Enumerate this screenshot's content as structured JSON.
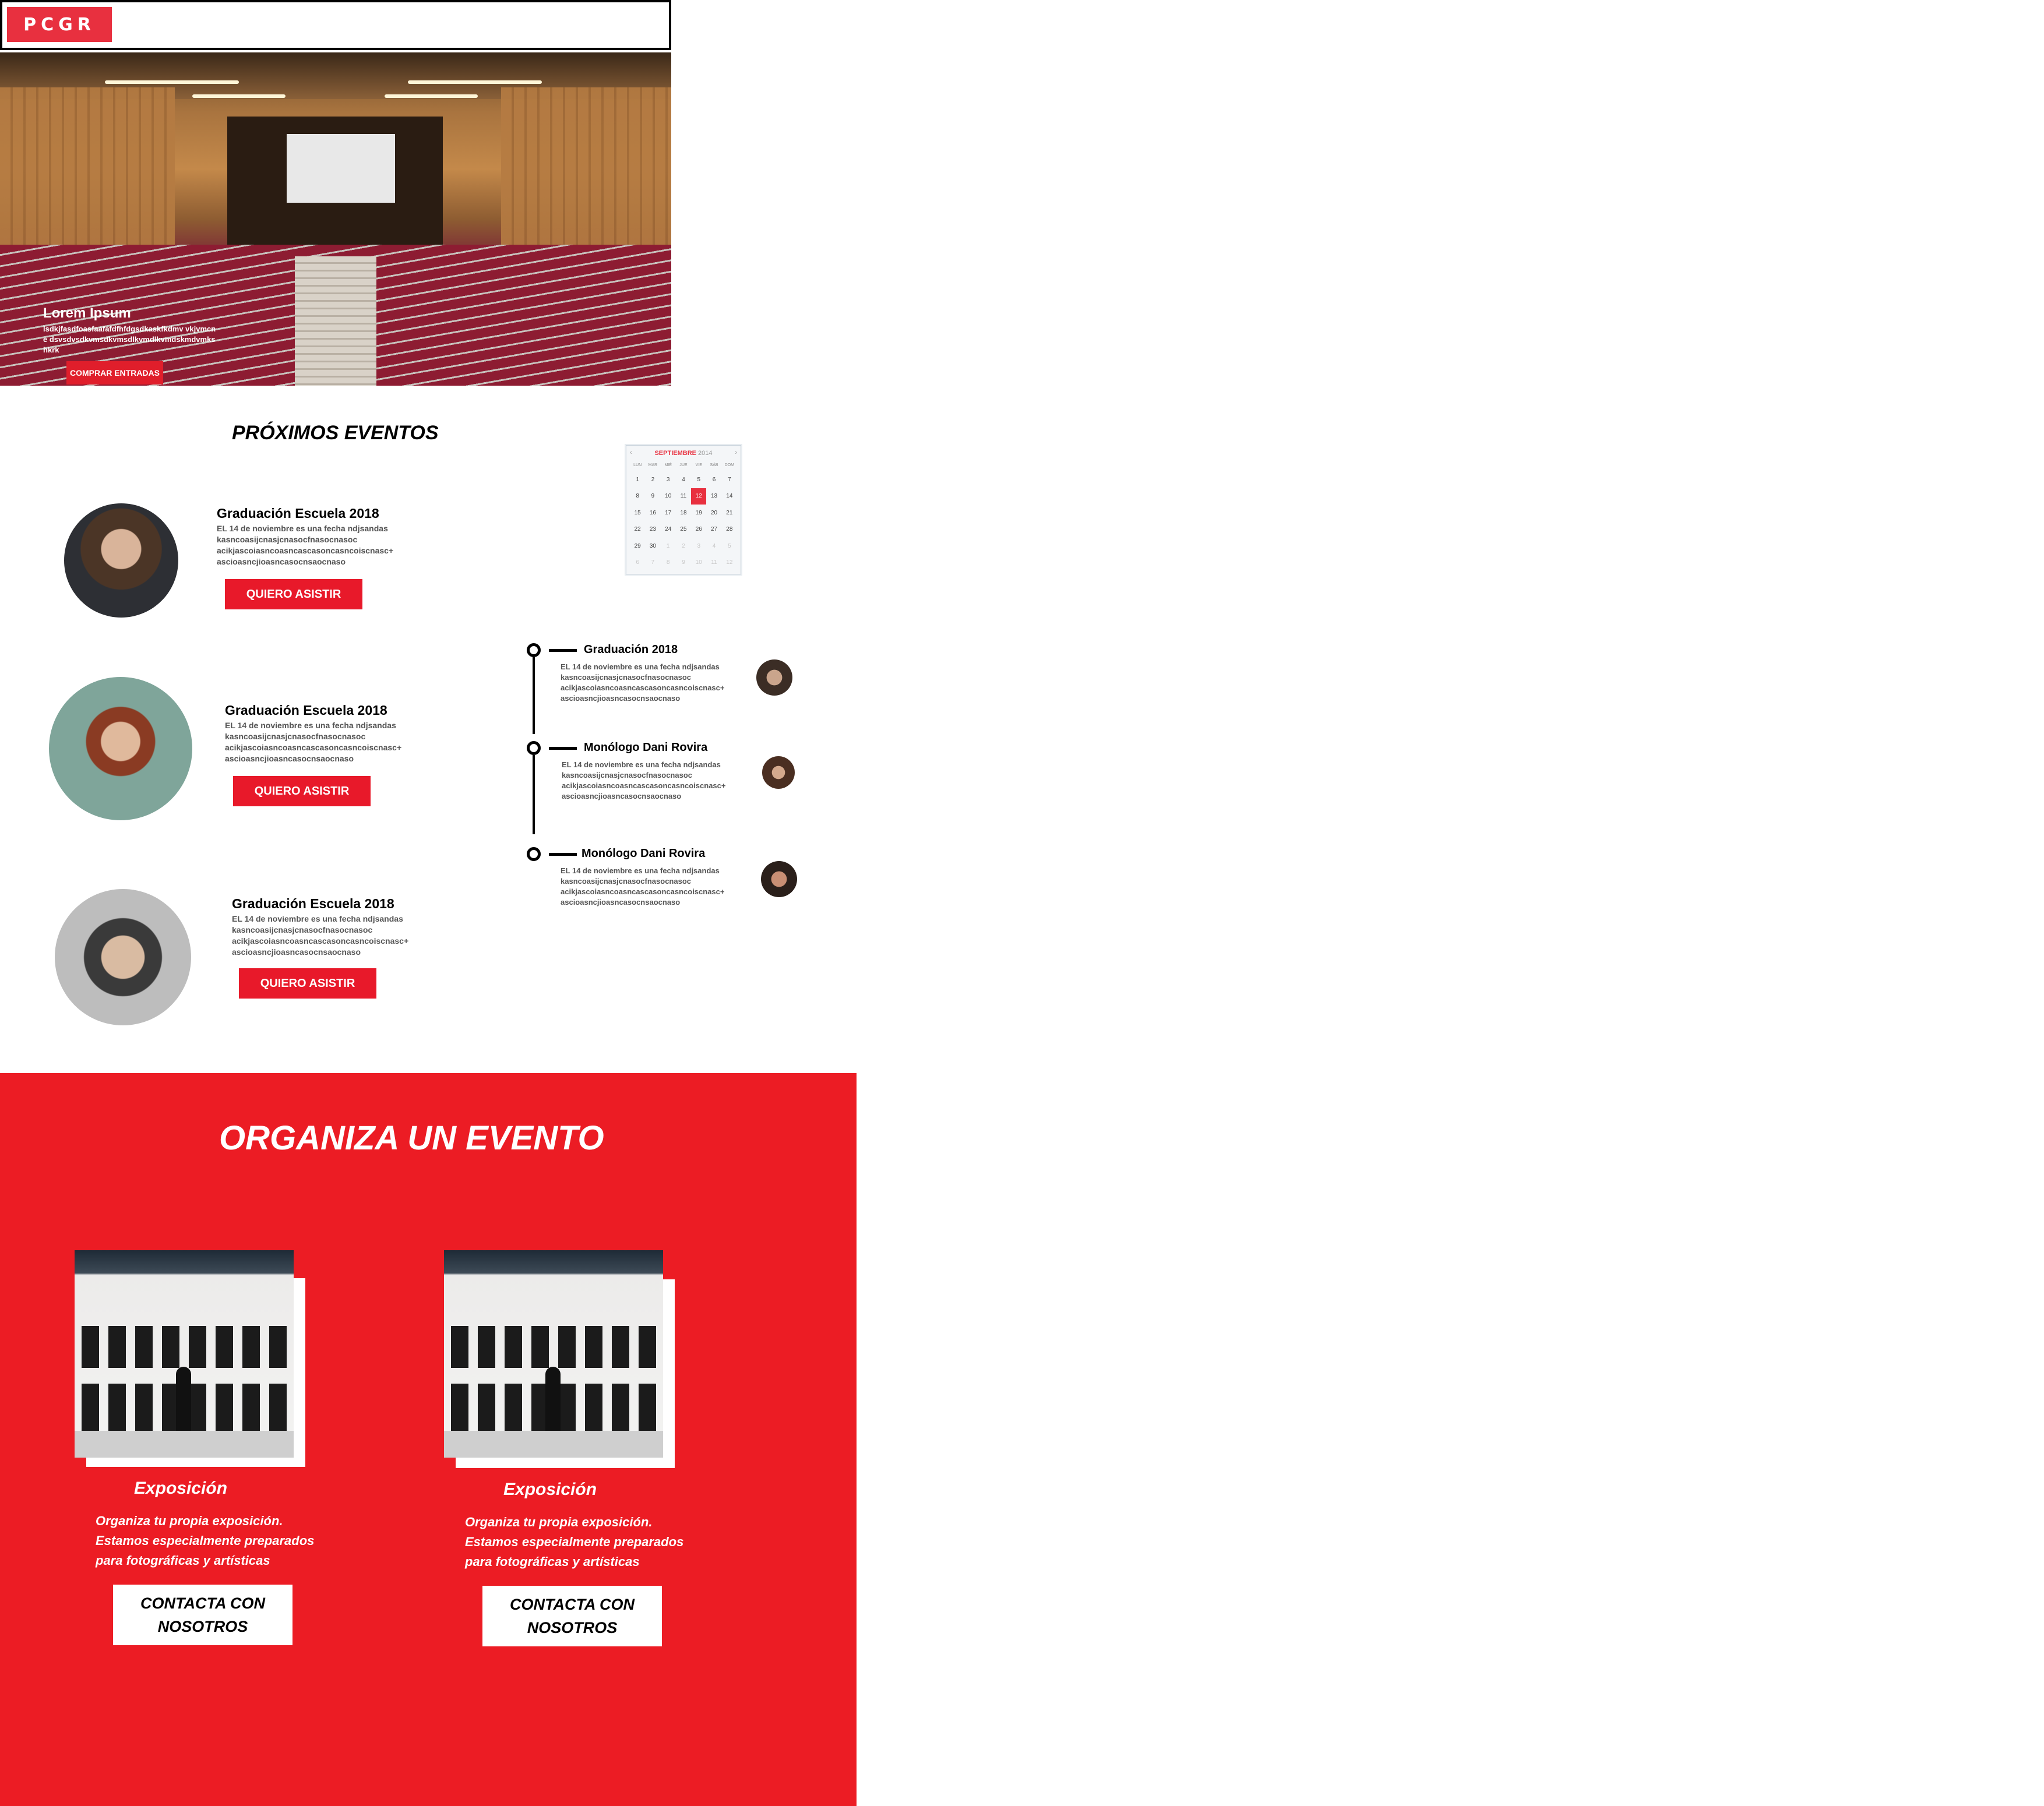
{
  "header": {
    "logo_text": "PCGR"
  },
  "hero": {
    "title": "Lorem Ipsum",
    "text": "lsdkjfasdfoasfaafafdfhfdgsdkaskfkdmv vkjvmcne dsvsdvsdkvmsdkvmsdlkvmdlkvmdskmdvmks hkrk",
    "button": "COMPRAR ENTRADAS"
  },
  "events": {
    "section_title": "PRÓXIMOS EVENTOS",
    "items": [
      {
        "title": "Graduación Escuela 2018",
        "desc": [
          "EL 14 de noviembre es una fecha ndjsandas",
          "kasncoasijcnasjcnasocfnasocnasoc",
          "acikjascoiasncoasncascasoncasncoiscnasc+",
          "ascioasncjioasncasocnsaocnaso"
        ],
        "button": "QUIERO ASISTIR"
      },
      {
        "title": "Graduación Escuela 2018",
        "desc": [
          "EL 14 de noviembre es una fecha ndjsandas",
          "kasncoasijcnasjcnasocfnasocnasoc",
          "acikjascoiasncoasncascasoncasncoiscnasc+",
          "ascioasncjioasncasocnsaocnaso"
        ],
        "button": "QUIERO ASISTIR"
      },
      {
        "title": "Graduación Escuela 2018",
        "desc": [
          "EL 14 de noviembre es una fecha ndjsandas",
          "kasncoasijcnasjcnasocfnasocnasoc",
          "acikjascoiasncoasncascasoncasncoiscnasc+",
          "ascioasncjioasncasocnsaocnaso"
        ],
        "button": "QUIERO ASISTIR"
      }
    ]
  },
  "calendar": {
    "month": "SEPTIEMBRE",
    "year": "2014",
    "prev": "‹",
    "next": "›",
    "dow": [
      "LUN",
      "MAR",
      "MIÉ",
      "JUE",
      "VIE",
      "SÁB",
      "DOM"
    ],
    "days": [
      "1",
      "2",
      "3",
      "4",
      "5",
      "6",
      "7",
      "8",
      "9",
      "10",
      "11",
      "12",
      "13",
      "14",
      "15",
      "16",
      "17",
      "18",
      "19",
      "20",
      "21",
      "22",
      "23",
      "24",
      "25",
      "26",
      "27",
      "28",
      "29",
      "30",
      "1",
      "2",
      "3",
      "4",
      "5",
      "6",
      "7",
      "8",
      "9",
      "10",
      "11",
      "12"
    ],
    "selected_index": 11,
    "muted_from_index": 30,
    "selected_color": "#e8303f"
  },
  "timeline": {
    "items": [
      {
        "title": "Graduación 2018",
        "desc": [
          "EL 14 de noviembre es una fecha ndjsandas",
          "kasncoasijcnasjcnasocfnasocnasoc",
          "acikjascoiasncoasncascasoncasncoiscnasc+",
          "ascioasncjioasncasocnsaocnaso"
        ]
      },
      {
        "title": "Monólogo Dani Rovira",
        "desc": [
          "EL 14 de noviembre es una fecha ndjsandas",
          "kasncoasijcnasjcnasocfnasocnasoc",
          "acikjascoiasncoasncascasoncasncoiscnasc+",
          "ascioasncjioasncasocnsaocnaso"
        ]
      },
      {
        "title": "Monólogo Dani Rovira",
        "desc": [
          "EL 14 de noviembre es una fecha ndjsandas",
          "kasncoasijcnasjcnasocfnasocnasoc",
          "acikjascoiasncoasncascasoncasncoiscnasc+",
          "ascioasncjioasncasocnsaocnaso"
        ]
      }
    ]
  },
  "organize": {
    "title": "ORGANIZA UN EVENTO",
    "cards": [
      {
        "caption": "Exposición",
        "text": [
          "Organiza tu propia exposición.",
          "Estamos especialmente preparados",
          "para fotográficas y artísticas"
        ],
        "button_line1": "CONTACTA CON",
        "button_line2": "NOSOTROS"
      },
      {
        "caption": "Exposición",
        "text": [
          "Organiza tu propia exposición.",
          "Estamos especialmente preparados",
          "para fotográficas y artísticas"
        ],
        "button_line1": "CONTACTA CON",
        "button_line2": "NOSOTROS"
      }
    ],
    "background_color": "#ec1c24"
  },
  "colors": {
    "accent": "#e8192a",
    "brand": "#e8303f"
  }
}
